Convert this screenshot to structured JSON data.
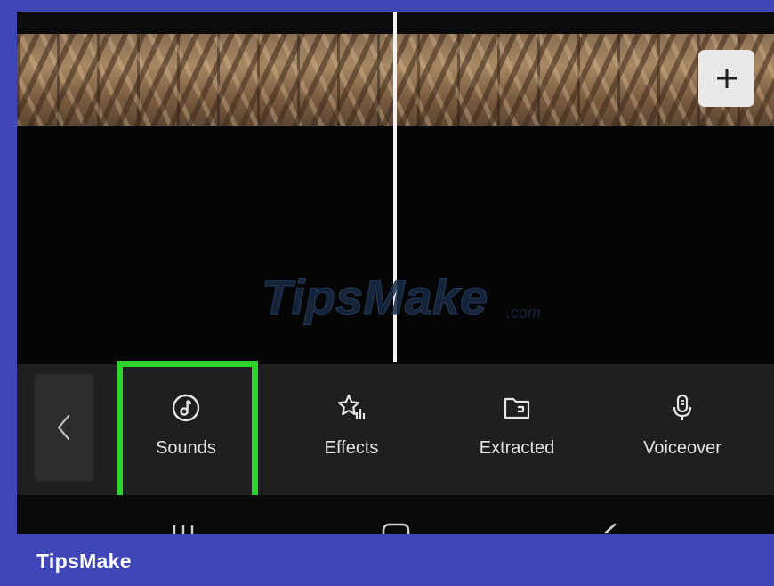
{
  "timeline": {
    "add_icon": "plus-icon"
  },
  "watermark": {
    "text": "TipsMake",
    "suffix": ".com"
  },
  "toolbar": {
    "back_icon": "chevron-left-icon",
    "tools": [
      {
        "label": "Sounds",
        "icon": "music-note-icon",
        "highlighted": true
      },
      {
        "label": "Effects",
        "icon": "star-effects-icon",
        "highlighted": false
      },
      {
        "label": "Extracted",
        "icon": "folder-icon",
        "highlighted": false
      },
      {
        "label": "Voiceover",
        "icon": "microphone-icon",
        "highlighted": false
      }
    ],
    "highlight_color": "#2bd52b"
  },
  "navbar": {
    "icons": [
      "recent-apps-icon",
      "home-icon",
      "back-icon"
    ]
  },
  "footer": {
    "brand": "TipsMake"
  }
}
